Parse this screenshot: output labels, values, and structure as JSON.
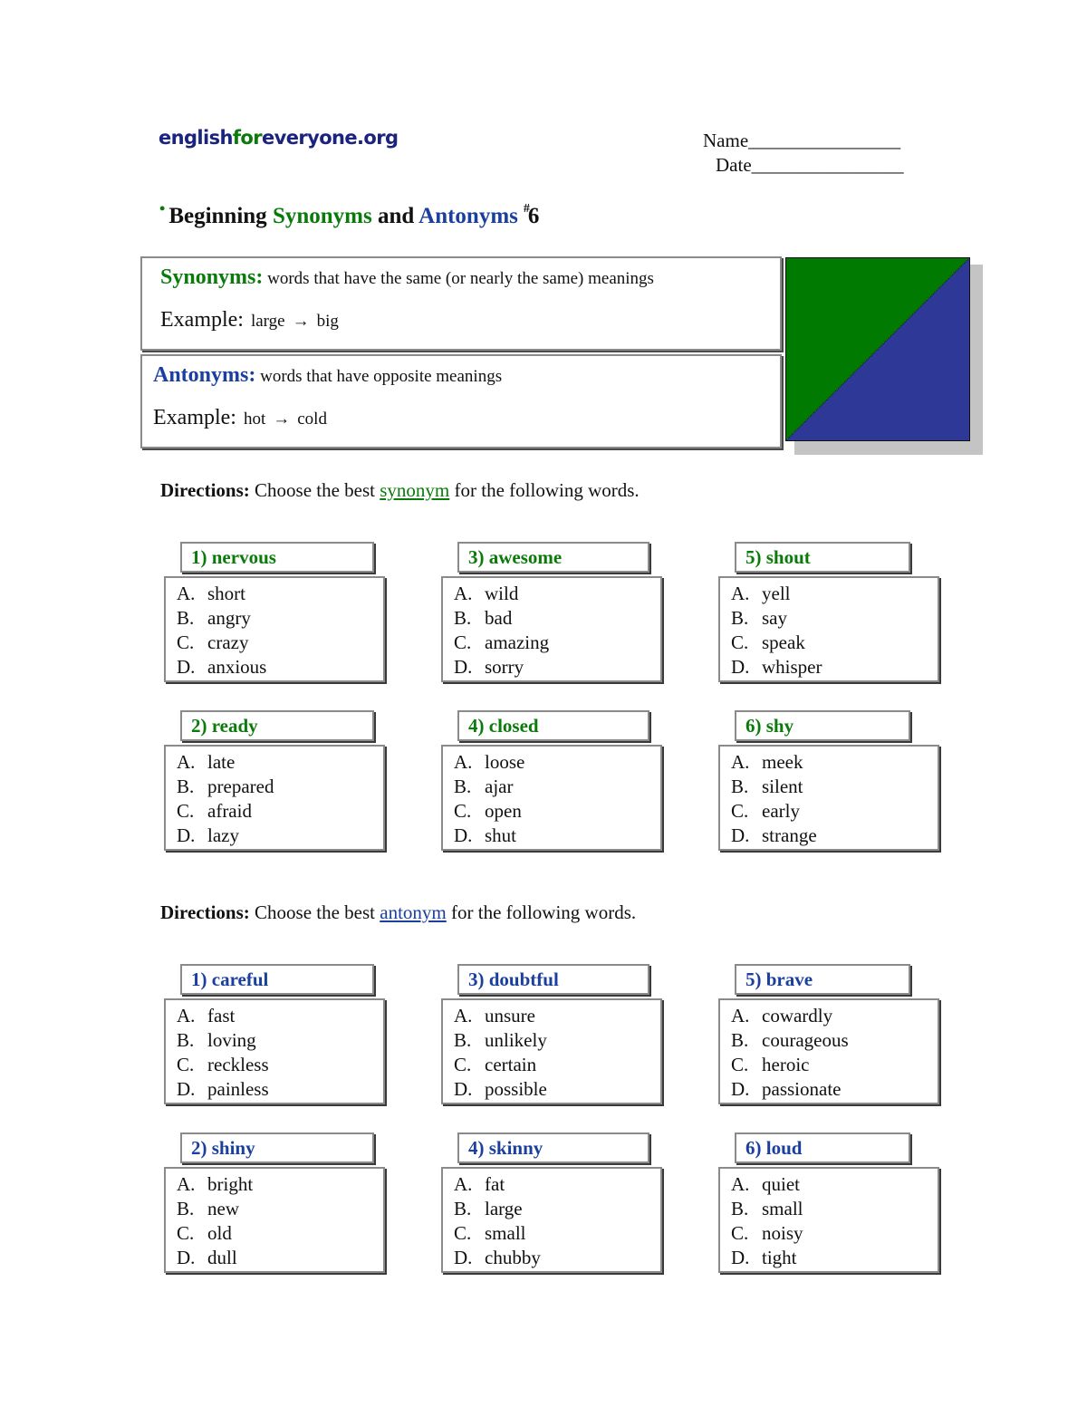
{
  "header": {
    "logo_prefix": "english",
    "logo_for": "for",
    "logo_suffix": "everyone.org",
    "name_label": "Name________________",
    "date_label": "Date________________"
  },
  "title": {
    "bullet": "•",
    "part1": "Beginning ",
    "synonyms": "Synonyms",
    "and": " and ",
    "antonyms": "Antonyms",
    "hash": "#",
    "number": "6"
  },
  "definitions": {
    "synonyms": {
      "term": "Synonyms:",
      "definition": " words that have the same (or nearly the same) meanings",
      "example_label": "Example:",
      "example_from": "large",
      "arrow": "→",
      "example_to": "big"
    },
    "antonyms": {
      "term": "Antonyms:",
      "definition": " words that have opposite meanings",
      "example_label": "Example:",
      "example_from": "hot",
      "arrow": "→",
      "example_to": "cold"
    }
  },
  "colors": {
    "synonym_green": "#0a7a0a",
    "antonym_blue": "#1a3f9e",
    "graphic_green": "#007a00",
    "graphic_blue": "#2e3896"
  },
  "synonym_section": {
    "directions_label": "Directions:",
    "directions_pre": " Choose the best ",
    "directions_link": "synonym",
    "directions_post": " for the following words.",
    "questions": [
      {
        "title": "1) nervous",
        "options": [
          {
            "letter": "A.",
            "text": "short"
          },
          {
            "letter": "B.",
            "text": "angry"
          },
          {
            "letter": "C.",
            "text": "crazy"
          },
          {
            "letter": "D.",
            "text": "anxious"
          }
        ]
      },
      {
        "title": "2) ready",
        "options": [
          {
            "letter": "A.",
            "text": "late"
          },
          {
            "letter": "B.",
            "text": "prepared"
          },
          {
            "letter": "C.",
            "text": "afraid"
          },
          {
            "letter": "D.",
            "text": "lazy"
          }
        ]
      },
      {
        "title": "3) awesome",
        "options": [
          {
            "letter": "A.",
            "text": "wild"
          },
          {
            "letter": "B.",
            "text": "bad"
          },
          {
            "letter": "C.",
            "text": "amazing"
          },
          {
            "letter": "D.",
            "text": "sorry"
          }
        ]
      },
      {
        "title": "4) closed",
        "options": [
          {
            "letter": "A.",
            "text": "loose"
          },
          {
            "letter": "B.",
            "text": "ajar"
          },
          {
            "letter": "C.",
            "text": "open"
          },
          {
            "letter": "D.",
            "text": "shut"
          }
        ]
      },
      {
        "title": "5) shout",
        "options": [
          {
            "letter": "A.",
            "text": "yell"
          },
          {
            "letter": "B.",
            "text": "say"
          },
          {
            "letter": "C.",
            "text": "speak"
          },
          {
            "letter": "D.",
            "text": "whisper"
          }
        ]
      },
      {
        "title": "6) shy",
        "options": [
          {
            "letter": "A.",
            "text": "meek"
          },
          {
            "letter": "B.",
            "text": "silent"
          },
          {
            "letter": "C.",
            "text": "early"
          },
          {
            "letter": "D.",
            "text": "strange"
          }
        ]
      }
    ]
  },
  "antonym_section": {
    "directions_label": "Directions:",
    "directions_pre": " Choose the best ",
    "directions_link": "antonym",
    "directions_post": " for the following words.",
    "questions": [
      {
        "title": "1) careful",
        "options": [
          {
            "letter": "A.",
            "text": "fast"
          },
          {
            "letter": "B.",
            "text": "loving"
          },
          {
            "letter": "C.",
            "text": "reckless"
          },
          {
            "letter": "D.",
            "text": "painless"
          }
        ]
      },
      {
        "title": "2) shiny",
        "options": [
          {
            "letter": "A.",
            "text": "bright"
          },
          {
            "letter": "B.",
            "text": "new"
          },
          {
            "letter": "C.",
            "text": "old"
          },
          {
            "letter": "D.",
            "text": "dull"
          }
        ]
      },
      {
        "title": "3) doubtful",
        "options": [
          {
            "letter": "A.",
            "text": "unsure"
          },
          {
            "letter": "B.",
            "text": "unlikely"
          },
          {
            "letter": "C.",
            "text": "certain"
          },
          {
            "letter": "D.",
            "text": "possible"
          }
        ]
      },
      {
        "title": "4) skinny",
        "options": [
          {
            "letter": "A.",
            "text": "fat"
          },
          {
            "letter": "B.",
            "text": "large"
          },
          {
            "letter": "C.",
            "text": "small"
          },
          {
            "letter": "D.",
            "text": "chubby"
          }
        ]
      },
      {
        "title": "5) brave",
        "options": [
          {
            "letter": "A.",
            "text": "cowardly"
          },
          {
            "letter": "B.",
            "text": "courageous"
          },
          {
            "letter": "C.",
            "text": "heroic"
          },
          {
            "letter": "D.",
            "text": "passionate"
          }
        ]
      },
      {
        "title": "6) loud",
        "options": [
          {
            "letter": "A.",
            "text": "quiet"
          },
          {
            "letter": "B.",
            "text": "small"
          },
          {
            "letter": "C.",
            "text": "noisy"
          },
          {
            "letter": "D.",
            "text": "tight"
          }
        ]
      }
    ]
  }
}
